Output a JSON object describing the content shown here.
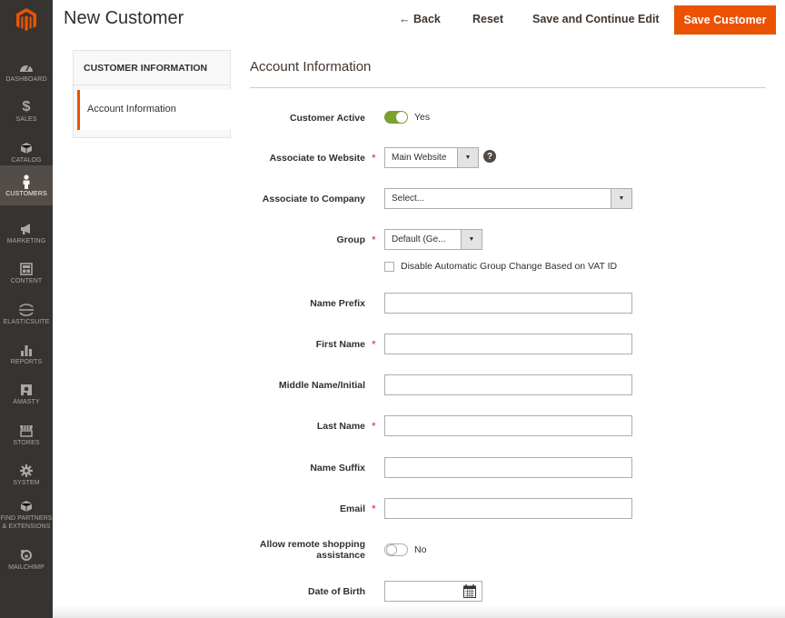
{
  "sidebar": {
    "items": [
      {
        "label": "DASHBOARD",
        "icon": "dashboard-icon"
      },
      {
        "label": "SALES",
        "icon": "dollar-icon"
      },
      {
        "label": "CATALOG",
        "icon": "cube-icon"
      },
      {
        "label": "CUSTOMERS",
        "icon": "person-icon"
      },
      {
        "label": "MARKETING",
        "icon": "megaphone-icon"
      },
      {
        "label": "CONTENT",
        "icon": "layout-icon"
      },
      {
        "label": "ELASTICSUITE",
        "icon": "elastic-icon"
      },
      {
        "label": "REPORTS",
        "icon": "bar-chart-icon"
      },
      {
        "label": "AMASTY",
        "icon": "amasty-icon"
      },
      {
        "label": "STORES",
        "icon": "store-icon"
      },
      {
        "label": "SYSTEM",
        "icon": "gear-icon"
      },
      {
        "label": "FIND PARTNERS & EXTENSIONS",
        "icon": "partners-icon"
      },
      {
        "label": "MAILCHIMP",
        "icon": "mailchimp-icon"
      }
    ],
    "active": "CUSTOMERS"
  },
  "header": {
    "title": "New Customer",
    "back_label": "← Back",
    "reset_label": "Reset",
    "save_continue_label": "Save and Continue Edit",
    "save_label": "Save Customer"
  },
  "tabs": {
    "title": "CUSTOMER INFORMATION",
    "active_item": "Account Information"
  },
  "form": {
    "section_title": "Account Information",
    "customer_active": {
      "label": "Customer Active",
      "value": "Yes"
    },
    "website": {
      "label": "Associate to Website",
      "value": "Main Website"
    },
    "company": {
      "label": "Associate to Company",
      "value": "Select..."
    },
    "group": {
      "label": "Group",
      "value": "Default (Ge...",
      "checkbox_label": "Disable Automatic Group Change Based on VAT ID"
    },
    "name_prefix": {
      "label": "Name Prefix"
    },
    "first_name": {
      "label": "First Name"
    },
    "middle_name": {
      "label": "Middle Name/Initial"
    },
    "last_name": {
      "label": "Last Name"
    },
    "name_suffix": {
      "label": "Name Suffix"
    },
    "email": {
      "label": "Email"
    },
    "remote_assist": {
      "label_line1": "Allow remote shopping",
      "label_line2": "assistance",
      "value": "No"
    },
    "dob": {
      "label": "Date of Birth"
    }
  },
  "colors": {
    "accent": "#eb5202",
    "sidebar_bg": "#373330",
    "toggle_on": "#79a22e",
    "required": "#e22626"
  }
}
